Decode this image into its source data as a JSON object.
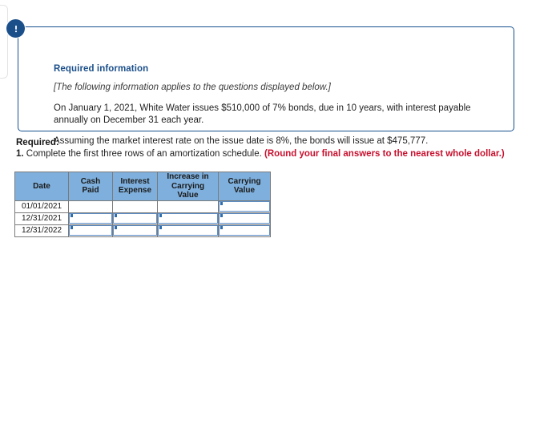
{
  "callout": {
    "icon": "exclamation-icon",
    "title": "Required information",
    "subtitle": "[The following information applies to the questions displayed below.]",
    "paragraph1": "On January 1, 2021, White Water issues $510,000 of 7% bonds, due in 10 years, with interest payable annually on December 31 each year.",
    "paragraph2": "Assuming the market interest rate on the issue date is 8%, the bonds will issue at $475,777.",
    "border_color": "#17508f",
    "badge_color": "#1b4f8a"
  },
  "prompt": {
    "label": "Required:",
    "number": "1.",
    "text": "Complete the first three rows of an amortization schedule.",
    "note": "(Round your final answers to the nearest whole dollar.)",
    "note_color": "#c8102e"
  },
  "schedule": {
    "header_color": "#7fb0dd",
    "input_border_color": "#5d8ec6",
    "columns": [
      "Date",
      "Cash Paid",
      "Interest Expense",
      "Increase in Carrying Value",
      "Carrying Value"
    ],
    "columns_wrapped": [
      [
        "Date"
      ],
      [
        "Cash Paid"
      ],
      [
        "Interest",
        "Expense"
      ],
      [
        "Increase in",
        "Carrying Value"
      ],
      [
        "Carrying",
        "Value"
      ]
    ],
    "rows": [
      {
        "date": "01/01/2021",
        "cash_paid": "",
        "interest_expense": "",
        "increase_in_carrying_value": "",
        "carrying_value": "",
        "editable": [
          false,
          false,
          false,
          true
        ]
      },
      {
        "date": "12/31/2021",
        "cash_paid": "",
        "interest_expense": "",
        "increase_in_carrying_value": "",
        "carrying_value": "",
        "editable": [
          true,
          true,
          true,
          true
        ]
      },
      {
        "date": "12/31/2022",
        "cash_paid": "",
        "interest_expense": "",
        "increase_in_carrying_value": "",
        "carrying_value": "",
        "editable": [
          true,
          true,
          true,
          true
        ]
      }
    ]
  }
}
